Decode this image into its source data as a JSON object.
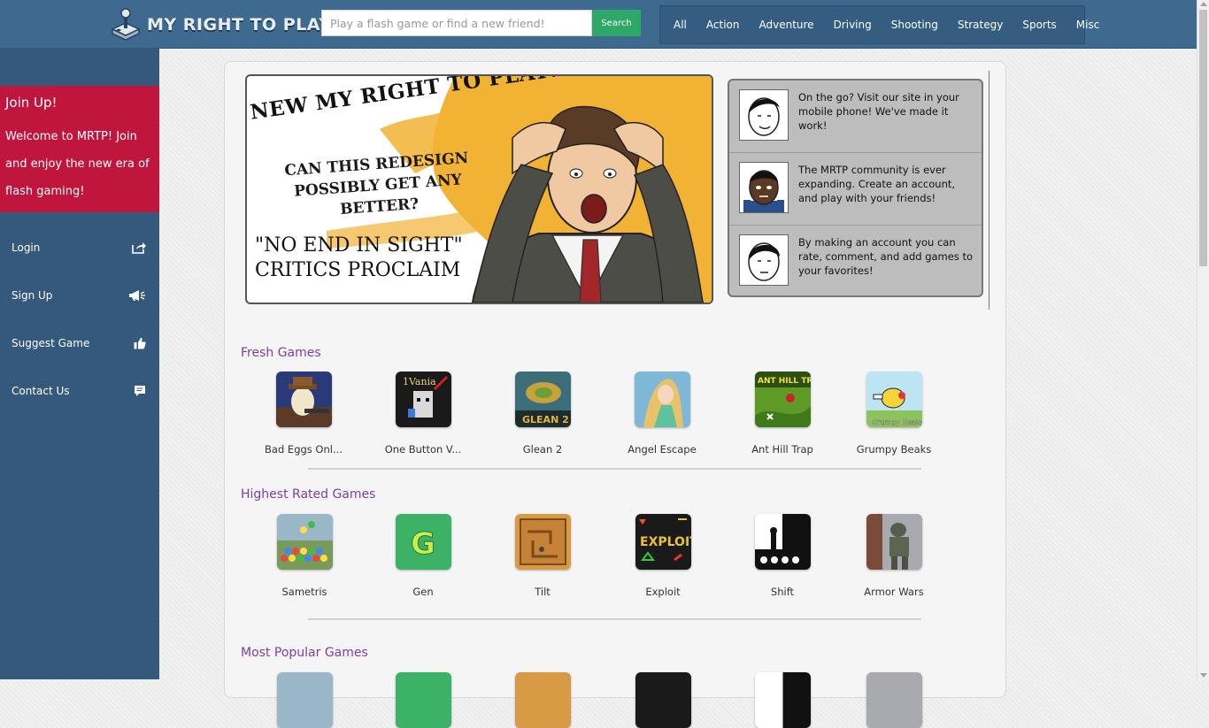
{
  "header": {
    "logo_text": "MY RIGHT TO PLAY",
    "search_placeholder": "Play a flash game or find a new friend!",
    "search_button": "Search",
    "categories": [
      "All",
      "Action",
      "Adventure",
      "Driving",
      "Shooting",
      "Strategy",
      "Sports",
      "Misc"
    ]
  },
  "sidebar": {
    "join_title": "Join Up!",
    "join_text": "Welcome to MRTP! Join and enjoy the new era of flash gaming!",
    "items": [
      {
        "label": "Login",
        "icon": "share-icon"
      },
      {
        "label": "Sign Up",
        "icon": "megaphone-icon"
      },
      {
        "label": "Suggest Game",
        "icon": "thumbs-up-icon"
      },
      {
        "label": "Contact Us",
        "icon": "chat-icon"
      }
    ]
  },
  "banner": {
    "line1": "NEW MY RIGHT TO PLAY!",
    "line2": "CAN THIS REDESIGN POSSIBLY GET ANY BETTER?",
    "line3": "\"NO END IN SIGHT\" CRITICS PROCLAIM"
  },
  "tips": [
    "On the go? Visit our site in your mobile phone! We've made it work!",
    "The MRTP community is ever expanding. Create an account, and play with your friends!",
    "By making an account you can rate, comment, and add games to your favorites!"
  ],
  "sections": [
    {
      "title": "Fresh Games",
      "games": [
        "Bad Eggs Onl...",
        "One Button V...",
        "Glean 2",
        "Angel Escape",
        "Ant Hill Trap",
        "Grumpy Beaks"
      ]
    },
    {
      "title": "Highest Rated Games",
      "games": [
        "Sametris",
        "Gen",
        "Tilt",
        "Exploit",
        "Shift",
        "Armor Wars"
      ]
    },
    {
      "title": "Most Popular Games",
      "games": []
    }
  ],
  "colors": {
    "header_bg": "#3e6a90",
    "sidebar_bg": "#35597d",
    "join_bg": "#c0153c",
    "search_button": "#2ea866",
    "section_title": "#7b3fa8"
  }
}
